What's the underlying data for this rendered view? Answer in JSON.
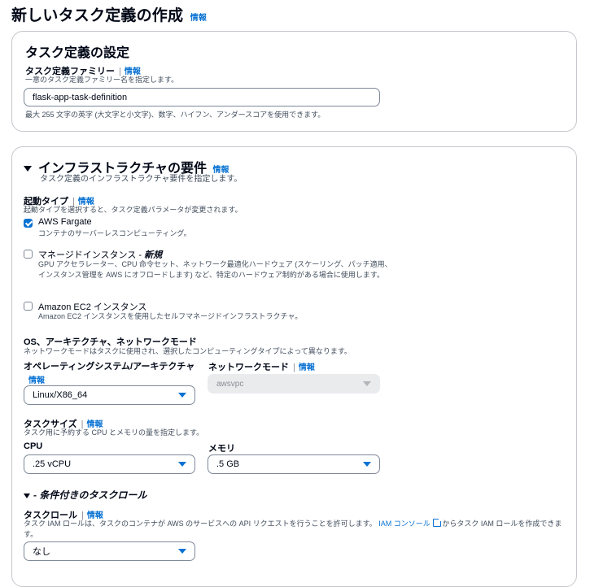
{
  "page": {
    "title": "新しいタスク定義の作成",
    "info": "情報"
  },
  "task_settings": {
    "heading": "タスク定義の設定",
    "family_label": "タスク定義ファミリー",
    "family_info": "情報",
    "family_desc": "一意のタスク定義ファミリー名を指定します。",
    "family_value": "flask-app-task-definition",
    "family_hint": "最大 255 文字の英字 (大文字と小文字)、数字、ハイフン、アンダースコアを使用できます。"
  },
  "infra": {
    "heading": "インフラストラクチャの要件",
    "info": "情報",
    "desc": "タスク定義のインフラストラクチャ要件を指定します。",
    "launch_type": {
      "label": "起動タイプ",
      "info": "情報",
      "desc": "起動タイプを選択すると、タスク定義パラメータが変更されます。",
      "options": [
        {
          "label": "AWS Fargate",
          "label_suffix": "",
          "desc": "コンテナのサーバーレスコンピューティング。",
          "checked": true
        },
        {
          "label": "マネージドインスタンス - ",
          "label_suffix": "新規",
          "desc": "GPU アクセラレーター、CPU 命令セット、ネットワーク最適化ハードウェア (スケーリング、パッチ適用、インスタンス管理を AWS にオフロードします) など、特定のハードウェア制約がある場合に使用します。",
          "checked": false
        },
        {
          "label": "Amazon EC2 インスタンス",
          "label_suffix": "",
          "desc": "Amazon EC2 インスタンスを使用したセルフマネージドインフラストラクチャ。",
          "checked": false
        }
      ]
    },
    "os_arch": {
      "label": "OS、アーキテクチャ、ネットワークモード",
      "desc": "ネットワークモードはタスクに使用され、選択したコンピューティングタイプによって異なります。",
      "os_label": "オペレーティングシステム/アーキテクチャ",
      "os_info": "情報",
      "os_value": "Linux/X86_64",
      "net_label": "ネットワークモード",
      "net_info": "情報",
      "net_value": "awsvpc"
    },
    "task_size": {
      "label": "タスクサイズ",
      "info": "情報",
      "desc": "タスク用に予約する CPU とメモリの量を指定します。",
      "cpu_label": "CPU",
      "cpu_value": ".25 vCPU",
      "mem_label": "メモリ",
      "mem_value": ".5 GB"
    },
    "task_role_section": {
      "heading": "- 条件付きのタスクロール",
      "label": "タスクロール",
      "info": "情報",
      "desc_before": "タスク IAM ロールは、タスクのコンテナが AWS のサービスへの API リクエストを行うことを許可します。",
      "link": "IAM コンソール",
      "desc_after": "からタスク IAM ロールを作成できます。",
      "value": "なし"
    }
  },
  "colors": {
    "accent": "#0972d3",
    "border": "#c6c6cd",
    "text": "#000716",
    "muted": "#414d5c"
  }
}
